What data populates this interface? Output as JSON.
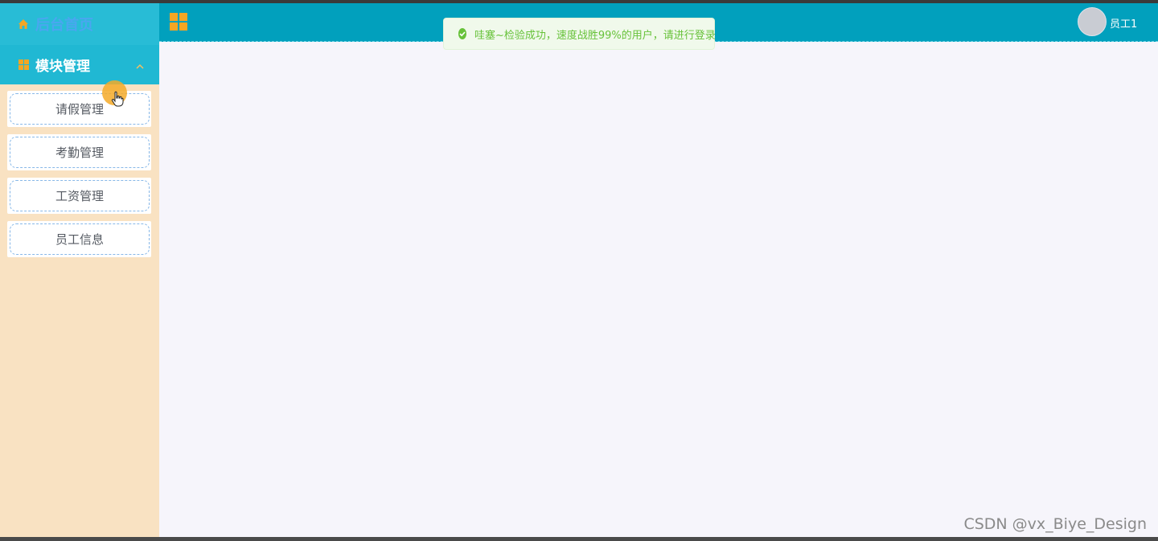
{
  "sidebar": {
    "home_label": "后台首页",
    "module_label": "模块管理",
    "items": [
      {
        "label": "请假管理"
      },
      {
        "label": "考勤管理"
      },
      {
        "label": "工资管理"
      },
      {
        "label": "员工信息"
      }
    ]
  },
  "header": {
    "title": "",
    "username": "员工1"
  },
  "toast": {
    "type": "success",
    "message": "哇塞~检验成功，速度战胜99%的用户，请进行登录"
  },
  "watermark": "CSDN @vx_Biye_Design",
  "colors": {
    "header_bg": "#01a0bd",
    "sidebar_bg": "#f9e2c2",
    "sidebar_home_bg": "#28bcd6",
    "sidebar_module_bg": "#20b8d3",
    "accent": "#f5a623",
    "success": "#67c23a"
  }
}
